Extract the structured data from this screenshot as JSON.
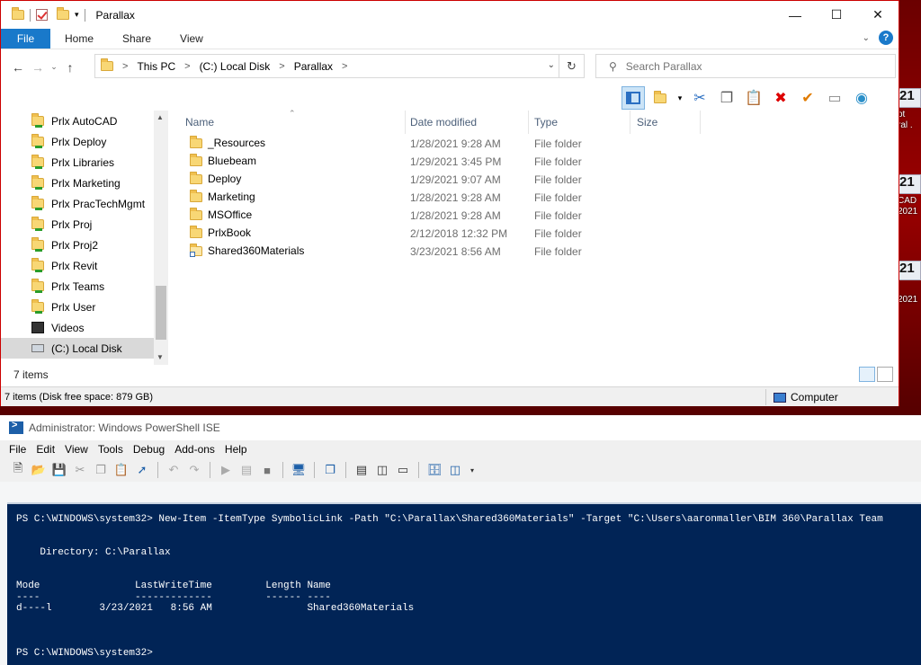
{
  "desktop": {
    "icons": [
      {
        "num": "21",
        "label": "ot\nral ."
      },
      {
        "num": "21",
        "label": "CAD\n2021"
      },
      {
        "num": "21",
        "label": "2021"
      }
    ]
  },
  "explorer": {
    "title": "Parallax",
    "ribbon_tabs": [
      "File",
      "Home",
      "Share",
      "View"
    ],
    "breadcrumb": [
      "This PC",
      "(C:) Local Disk",
      "Parallax"
    ],
    "search_placeholder": "Search Parallax",
    "nav_items": [
      {
        "label": "Prlx AutoCAD"
      },
      {
        "label": "Prlx Deploy"
      },
      {
        "label": "Prlx Libraries"
      },
      {
        "label": "Prlx Marketing"
      },
      {
        "label": "Prlx PracTechMgmt"
      },
      {
        "label": "Prlx Proj"
      },
      {
        "label": "Prlx Proj2"
      },
      {
        "label": "Prlx Revit"
      },
      {
        "label": "Prlx Teams"
      },
      {
        "label": "Prlx User"
      },
      {
        "label": "Videos"
      },
      {
        "label": "(C:) Local Disk"
      }
    ],
    "columns": {
      "name": "Name",
      "date": "Date modified",
      "type": "Type",
      "size": "Size"
    },
    "files": [
      {
        "name": "_Resources",
        "date": "1/28/2021 9:28 AM",
        "type": "File folder"
      },
      {
        "name": "Bluebeam",
        "date": "1/29/2021 3:45 PM",
        "type": "File folder"
      },
      {
        "name": "Deploy",
        "date": "1/29/2021 9:07 AM",
        "type": "File folder"
      },
      {
        "name": "Marketing",
        "date": "1/28/2021 9:28 AM",
        "type": "File folder"
      },
      {
        "name": "MSOffice",
        "date": "1/28/2021 9:28 AM",
        "type": "File folder"
      },
      {
        "name": "PrlxBook",
        "date": "2/12/2018 12:32 PM",
        "type": "File folder"
      },
      {
        "name": "Shared360Materials",
        "date": "3/23/2021 8:56 AM",
        "type": "File folder"
      }
    ],
    "item_count": "7 items",
    "status_free": "7 items (Disk free space: 879 GB)",
    "status_location": "Computer"
  },
  "ise": {
    "title": "Administrator: Windows PowerShell ISE",
    "menu": [
      "File",
      "Edit",
      "View",
      "Tools",
      "Debug",
      "Add-ons",
      "Help"
    ],
    "console_lines": [
      "PS C:\\WINDOWS\\system32> New-Item -ItemType SymbolicLink -Path \"C:\\Parallax\\Shared360Materials\" -Target \"C:\\Users\\aaronmaller\\BIM 360\\Parallax Team",
      "",
      "",
      "    Directory: C:\\Parallax",
      "",
      "",
      "Mode                LastWriteTime         Length Name",
      "----                -------------         ------ ----",
      "d----l        3/23/2021   8:56 AM                Shared360Materials",
      "",
      "",
      "",
      "PS C:\\WINDOWS\\system32>"
    ]
  }
}
